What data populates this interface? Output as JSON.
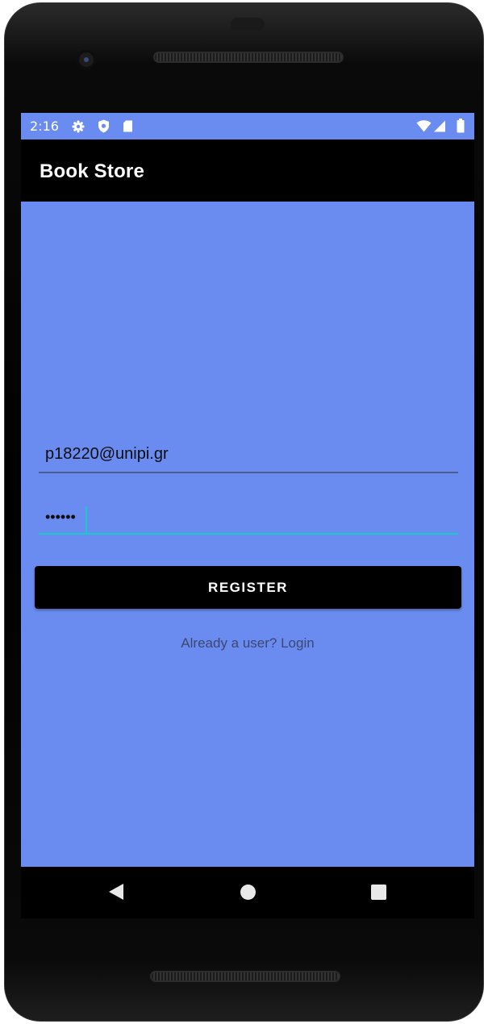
{
  "status_bar": {
    "time": "2:16",
    "icons": [
      "settings-icon",
      "shield-icon",
      "sd-card-icon",
      "wifi-icon",
      "signal-icon",
      "battery-icon"
    ]
  },
  "app_bar": {
    "title": "Book Store"
  },
  "form": {
    "email": {
      "value": "p18220@unipi.gr"
    },
    "password": {
      "value": "••••••"
    },
    "register_label": "REGISTER",
    "login_link": "Already a user? Login"
  },
  "nav_bar": {
    "icons": [
      "back-icon",
      "home-icon",
      "recents-icon"
    ]
  },
  "colors": {
    "background": "#6a8cf0",
    "app_bar": "#000000",
    "accent": "#1ac9c9",
    "button": "#000000"
  }
}
